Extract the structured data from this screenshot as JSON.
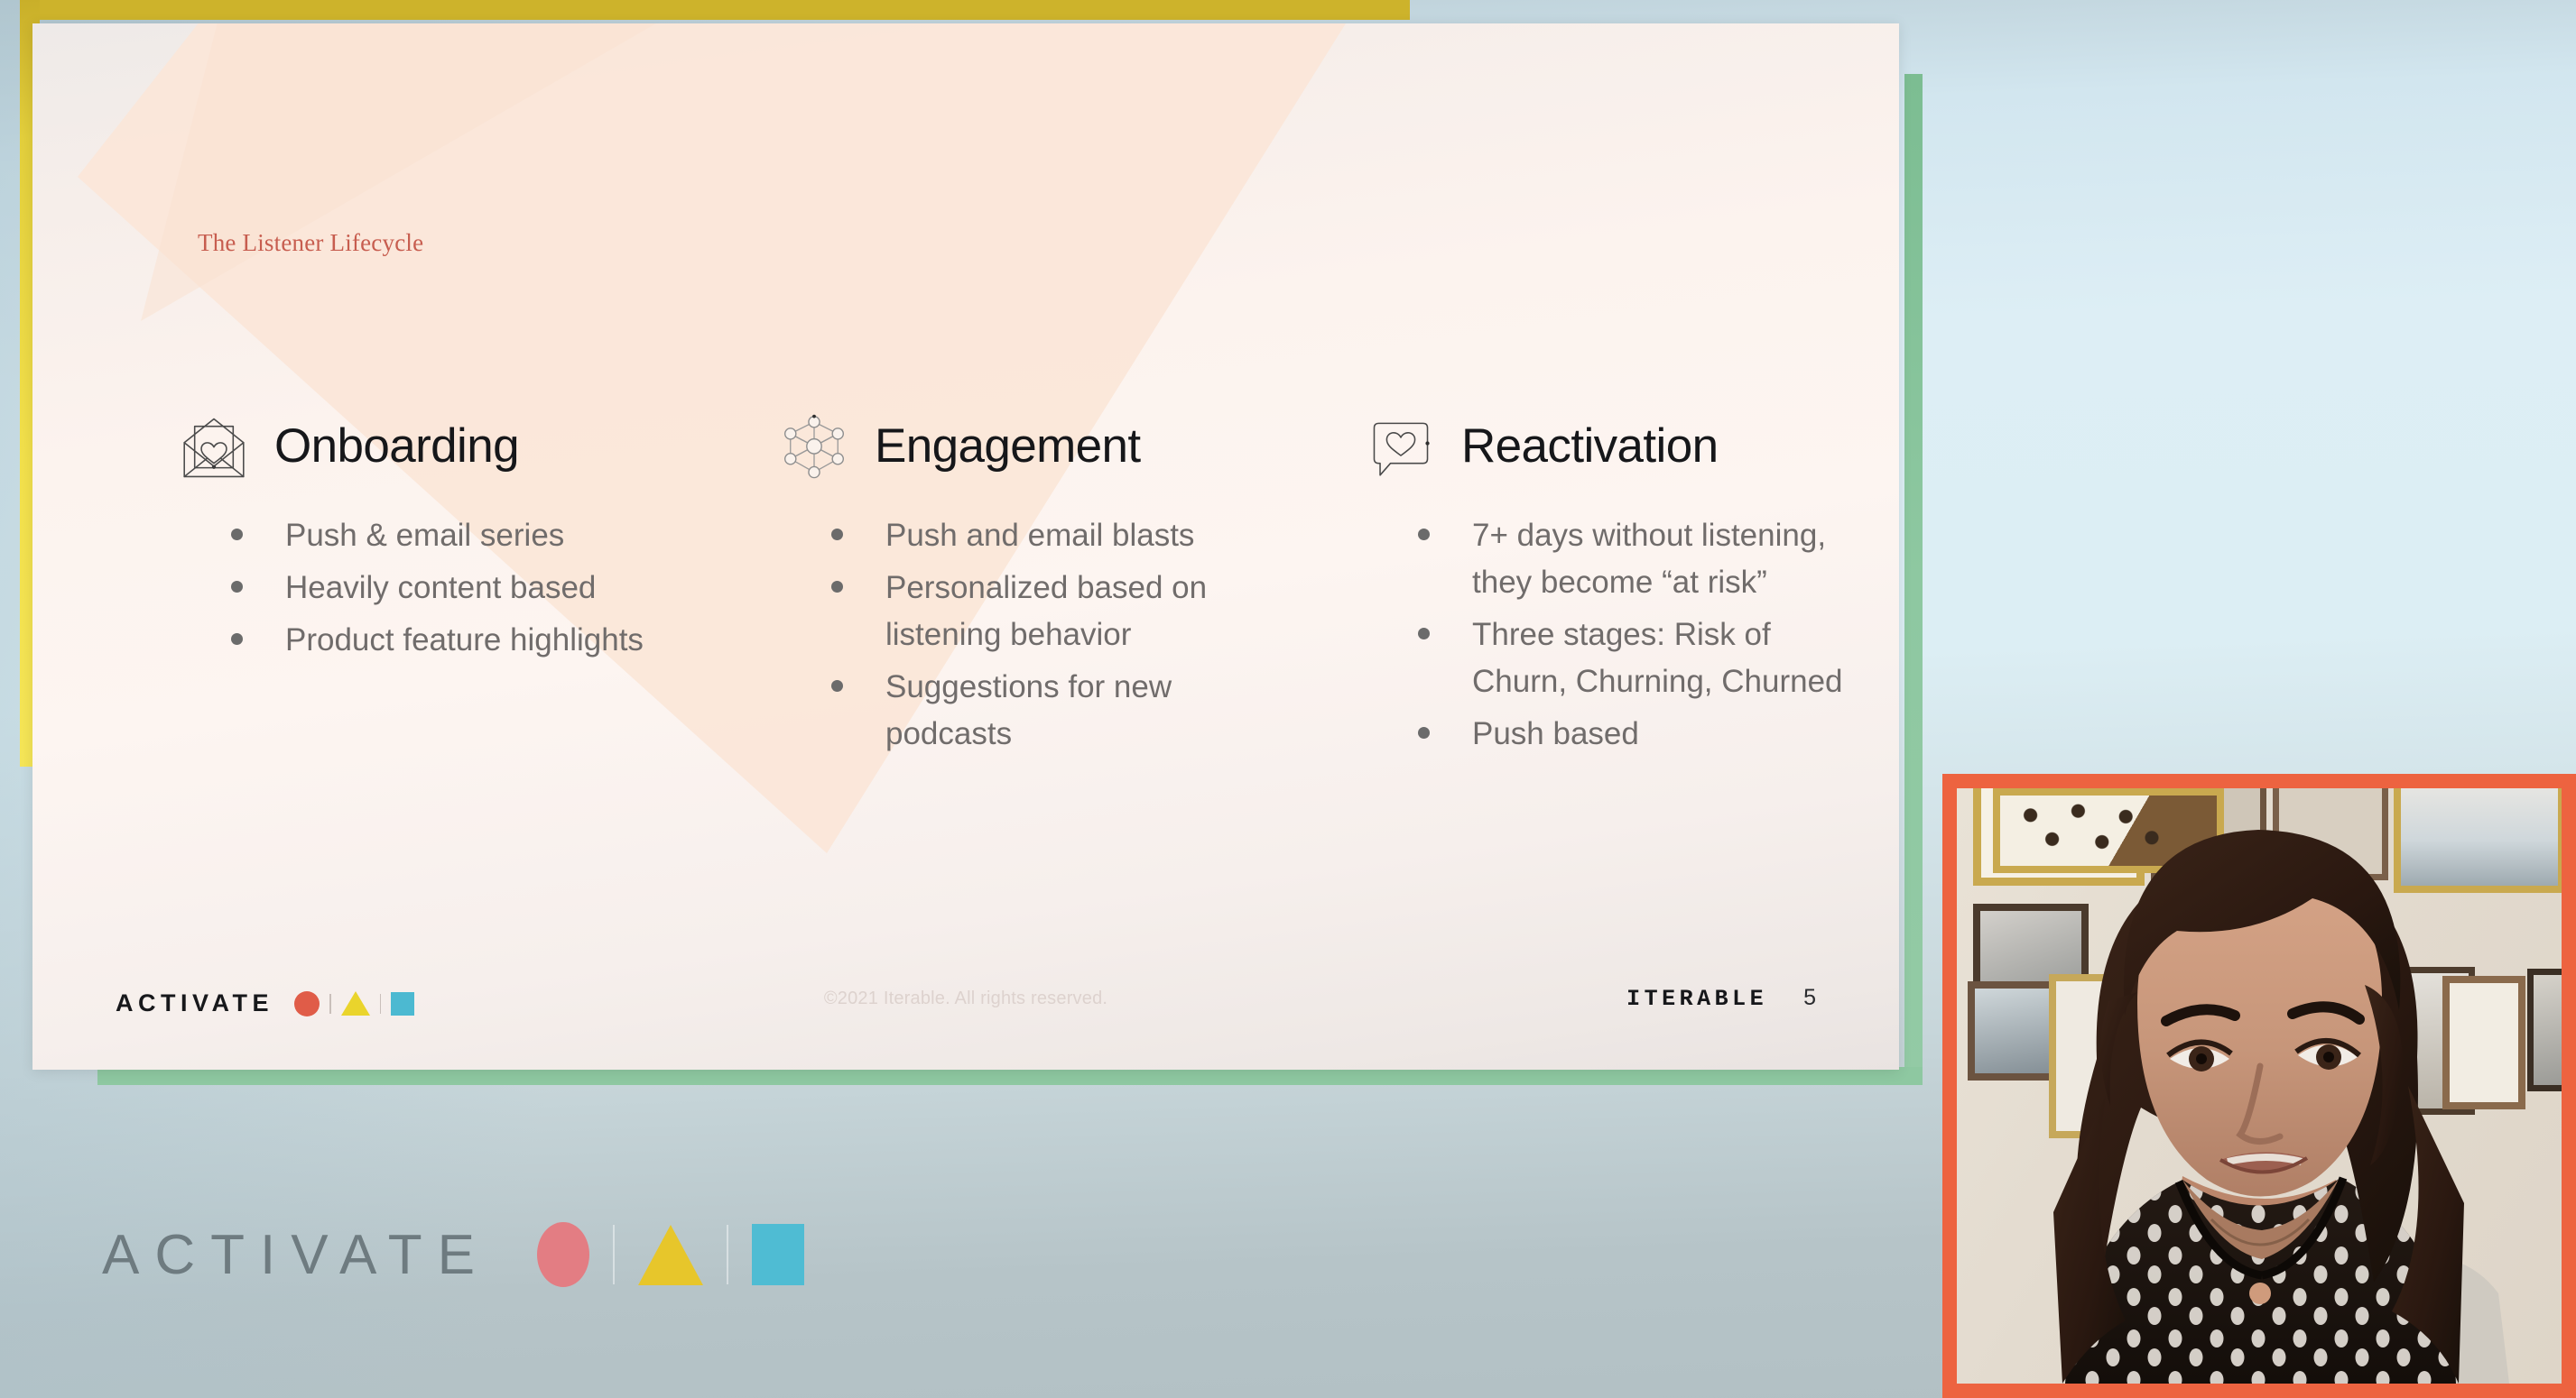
{
  "slide": {
    "title": "The Listener Lifecycle",
    "columns": [
      {
        "id": "onboarding",
        "heading": "Onboarding",
        "icon": "envelope-heart-icon",
        "bullets": [
          "Push & email series",
          "Heavily content based",
          "Product feature highlights"
        ]
      },
      {
        "id": "engagement",
        "heading": "Engagement",
        "icon": "network-nodes-icon",
        "bullets": [
          "Push and email blasts",
          "Personalized based on listening behavior",
          "Suggestions for new podcasts"
        ]
      },
      {
        "id": "reactivation",
        "heading": "Reactivation",
        "icon": "speech-bubble-heart-icon",
        "bullets": [
          "7+ days without listening, they become “at risk”",
          "Three stages: Risk of Churn, Churning, Churned",
          "Push based"
        ]
      }
    ],
    "footer": {
      "activate_word": "ACTIVATE",
      "copyright": "©2021 Iterable. All rights reserved.",
      "brand": "ITERABLE",
      "page_number": "5"
    }
  },
  "stage_logo": {
    "word": "ACTIVATE"
  },
  "video": {
    "participant_present": true
  },
  "colors": {
    "title_red": "#c75d4f",
    "accent_yellow": "#e8d33f",
    "accent_green": "#8ec8a1",
    "video_border_orange": "#ed6340",
    "logo_circle_red": "#e05c48",
    "logo_triangle_yellow": "#ead42c",
    "logo_square_cyan": "#4cb9d1",
    "big_circle_pink": "#e37d83",
    "big_triangle_yellow": "#e7c62b",
    "big_square_cyan": "#4fbcd3",
    "bullet_text_gray": "#706c6b",
    "heading_black": "#16171a",
    "stage_bg_top": "#b9ccd4",
    "slide_peach": "#fbeade"
  }
}
